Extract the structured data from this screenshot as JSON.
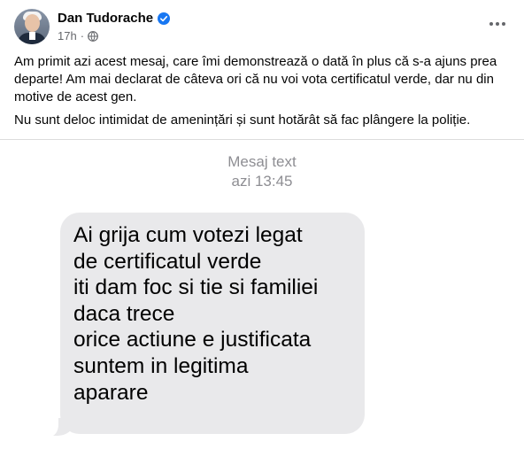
{
  "post": {
    "author_name": "Dan Tudorache",
    "timestamp": "17h",
    "separator": "·",
    "audience_icon": "globe-icon",
    "verified_icon": "verified-icon",
    "paragraphs": [
      "Am primit azi acest mesaj, care îmi demonstrează o dată în plus că s-a ajuns prea departe!  Am mai declarat de câteva ori că nu voi vota certificatul verde, dar nu din motive de acest gen.",
      "Nu sunt deloc intimidat de amenințări și sunt hotărât să fac plângere la poliție."
    ]
  },
  "sms": {
    "header_label": "Mesaj text",
    "header_time": "azi 13:45",
    "message_lines": [
      "Ai grija cum votezi legat",
      "de certificatul verde",
      "iti dam foc si tie si familiei",
      "daca trece",
      "orice actiune e justificata",
      "suntem in legitima",
      "aparare"
    ]
  },
  "colors": {
    "verified_blue": "#1877f2",
    "secondary_text": "#65676b",
    "bubble_gray": "#e9e9eb",
    "sms_header_gray": "#8e8e93"
  }
}
